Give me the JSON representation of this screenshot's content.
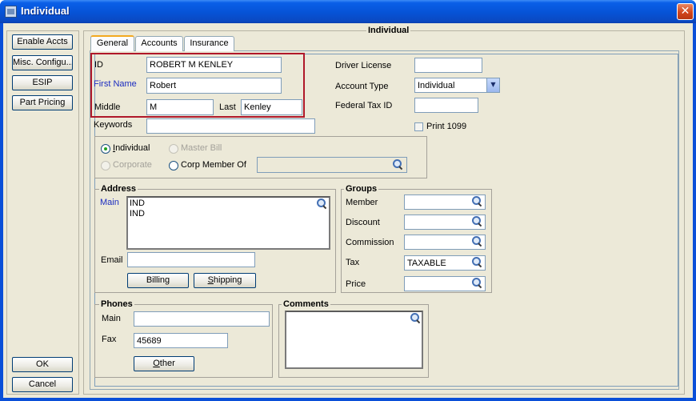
{
  "window": {
    "title": "Individual",
    "close_glyph": "✕"
  },
  "left_buttons": {
    "enable_accts": "Enable Accts",
    "misc_config": "Misc. Configu...",
    "esip": "ESIP",
    "part_pricing": "Part Pricing",
    "ok": "OK",
    "cancel": "Cancel"
  },
  "panel_title": "Individual",
  "tabs": [
    {
      "label": "General",
      "active": true
    },
    {
      "label": "Accounts",
      "active": false
    },
    {
      "label": "Insurance",
      "active": false
    }
  ],
  "general": {
    "id_label": "ID",
    "id_value": "ROBERT M KENLEY",
    "first_name_label": "First Name",
    "first_name_value": "Robert",
    "middle_label": "Middle",
    "middle_value": "M",
    "last_label": "Last",
    "last_value": "Kenley",
    "keywords_label": "Keywords",
    "keywords_value": "",
    "driver_license_label": "Driver License",
    "driver_license_value": "",
    "account_type_label": "Account Type",
    "account_type_value": "Individual",
    "federal_tax_label": "Federal Tax ID",
    "federal_tax_value": "",
    "print_1099_label": "Print 1099",
    "print_1099_checked": false
  },
  "entity_type": {
    "individual": "Individual",
    "master_bill": "Master Bill",
    "corporate": "Corporate",
    "corp_member_of": "Corp Member Of",
    "corp_member_value": "",
    "selected": "Individual"
  },
  "address": {
    "title": "Address",
    "main_label": "Main",
    "lines": [
      "IND",
      "IND"
    ],
    "email_label": "Email",
    "email_value": "",
    "billing_button": "Billing",
    "shipping_button": "Shipping"
  },
  "groups": {
    "title": "Groups",
    "member_label": "Member",
    "member_value": "",
    "discount_label": "Discount",
    "discount_value": "",
    "commission_label": "Commission",
    "commission_value": "",
    "tax_label": "Tax",
    "tax_value": "TAXABLE",
    "price_label": "Price",
    "price_value": ""
  },
  "phones": {
    "title": "Phones",
    "main_label": "Main",
    "main_value": "",
    "fax_label": "Fax",
    "fax_value": "45689",
    "other_button": "Other"
  },
  "comments": {
    "title": "Comments",
    "value": ""
  },
  "colors": {
    "title_bar": "#0a5fe8",
    "accent_red_box": "#b0182a",
    "label_blue": "#1b2cc0",
    "tab_highlight": "#f3a91f"
  },
  "icons": [
    "window-app-icon",
    "close-icon",
    "magnifier-icon",
    "combo-dropdown-arrow-icon"
  ]
}
